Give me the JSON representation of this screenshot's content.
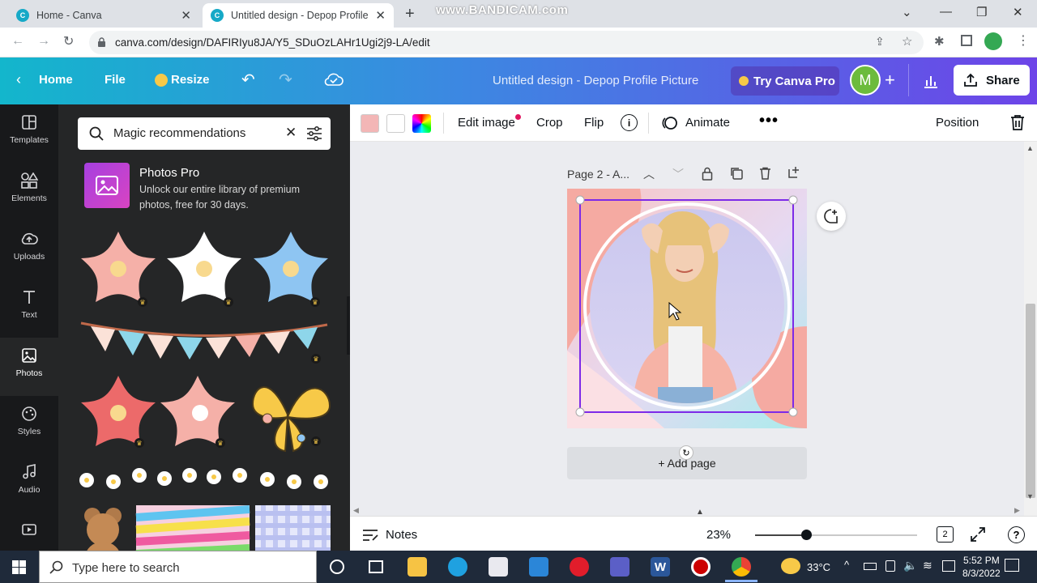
{
  "browser": {
    "tabs": [
      {
        "title": "Home - Canva",
        "active": false
      },
      {
        "title": "Untitled design - Depop Profile P",
        "active": true
      }
    ],
    "watermark": "www.BANDICAM.com",
    "url": "canva.com/design/DAFIRIyu8JA/Y5_SDuOzLAHr1Ugi2j9-LA/edit",
    "profile_initial": ""
  },
  "header": {
    "home_label": "Home",
    "file_label": "File",
    "resize_label": "Resize",
    "title": "Untitled design - Depop Profile Picture",
    "try_pro_label": "Try Canva Pro",
    "avatar_initial": "M",
    "share_label": "Share"
  },
  "rail": {
    "items": [
      {
        "label": "Templates",
        "icon": "templates-icon"
      },
      {
        "label": "Elements",
        "icon": "elements-icon"
      },
      {
        "label": "Uploads",
        "icon": "uploads-icon"
      },
      {
        "label": "Text",
        "icon": "text-icon"
      },
      {
        "label": "Photos",
        "icon": "photos-icon",
        "active": true
      },
      {
        "label": "Styles",
        "icon": "styles-icon"
      },
      {
        "label": "Audio",
        "icon": "audio-icon"
      }
    ]
  },
  "panel": {
    "search_value": "Magic recommendations",
    "promo_title": "Photos Pro",
    "promo_desc": "Unlock our entire library of premium photos, free for 30 days."
  },
  "toolbar": {
    "colors": [
      "#f3b6b6",
      "#ffffff"
    ],
    "edit_image_label": "Edit image",
    "crop_label": "Crop",
    "flip_label": "Flip",
    "animate_label": "Animate",
    "position_label": "Position"
  },
  "canvas": {
    "page_label": "Page 2 - A...",
    "add_page_label": "+ Add page"
  },
  "bottom": {
    "notes_label": "Notes",
    "zoom": "23%",
    "zoom_fraction": 0.23,
    "page_count": "2"
  },
  "taskbar": {
    "search_placeholder": "Type here to search",
    "temperature": "33°C",
    "time": "5:52 PM",
    "date": "8/3/2022"
  }
}
